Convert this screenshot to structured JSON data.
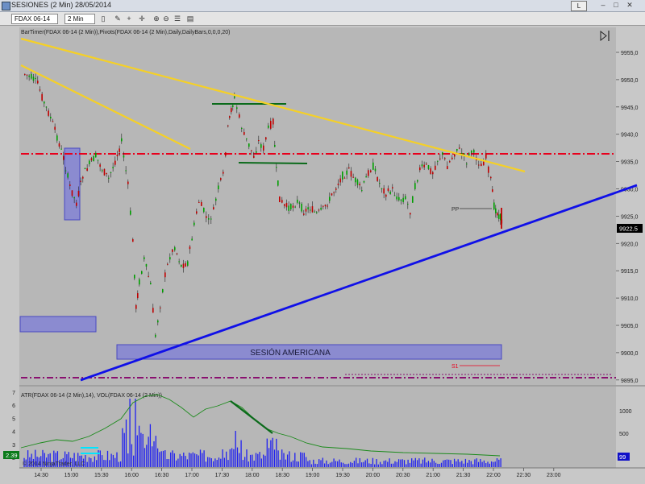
{
  "window": {
    "title": "SESIONES (2 Min)  28/05/2014",
    "layout_button": "L"
  },
  "toolbar": {
    "instrument": "FDAX 06-14",
    "period": "2 Min"
  },
  "main_panel": {
    "indicator_label": "BarTimer(FDAX 06-14 (2 Min)),Pivots(FDAX 06-14 (2 Min),Daily,DailyBars,0,0,0,20)",
    "session_label": "SESIÓN AMERICANA",
    "pivot_pp_label": "PP",
    "pivot_s1_label": "S1",
    "last_price": "9922.5",
    "price_ticks": [
      "9955,0",
      "9950,0",
      "9945,0",
      "9940,0",
      "9935,0",
      "9930,0",
      "9925,0",
      "9920,0",
      "9915,0",
      "9910,0",
      "9905,0",
      "9900,0",
      "9895,0"
    ]
  },
  "lower_panel": {
    "indicator_label": "ATR(FDAX 06-14 (2 Min),14), VOL(FDAX 06-14 (2 Min))",
    "left_value": "2.39",
    "right_value": "99",
    "left_ticks": [
      "7",
      "6",
      "5",
      "4",
      "3",
      "2"
    ],
    "right_ticks": [
      "1000",
      "500"
    ],
    "copyright": "© 2014 NinjaTrader, LLC"
  },
  "time_axis": {
    "labels": [
      "14:30",
      "15:00",
      "15:30",
      "16:00",
      "16:30",
      "17:00",
      "17:30",
      "18:00",
      "18:30",
      "19:00",
      "19:30",
      "20:00",
      "20:30",
      "21:00",
      "21:30",
      "22:00",
      "22:30",
      "23:00"
    ]
  },
  "colors": {
    "yellow_trend": "#f5d027",
    "blue_trend": "#1010e8",
    "resistance_red": "#e8001c",
    "support_purple": "#8a1070",
    "green_line": "#0a6a1a",
    "up_candle": "#00a000",
    "down_candle": "#c00000",
    "volume": "#2020f0",
    "atr": "#1a8a1a"
  }
}
